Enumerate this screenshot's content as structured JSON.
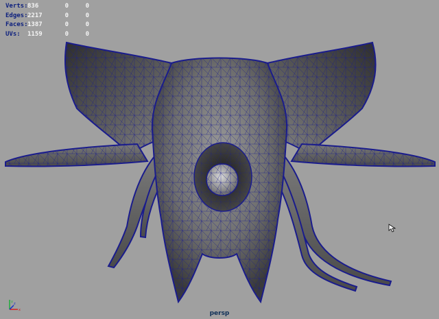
{
  "hud": {
    "rows": [
      {
        "label": "Verts:",
        "total": "836",
        "selected": "0",
        "components": "0"
      },
      {
        "label": "Edges:",
        "total": "2217",
        "selected": "0",
        "components": "0"
      },
      {
        "label": "Faces:",
        "total": "1387",
        "selected": "0",
        "components": "0"
      },
      {
        "label": "UVs:",
        "total": "1159",
        "selected": "0",
        "components": "0"
      }
    ]
  },
  "viewport": {
    "camera": "persp",
    "background": "#a0a0a0",
    "wire_color": "#1a1c8c",
    "shade_color": "#6a6a6a"
  },
  "axis": {
    "x": "x",
    "y": "y",
    "z": "z"
  },
  "icons": {
    "cursor": "pointer-arrow-icon",
    "axis": "view-axis-icon"
  }
}
